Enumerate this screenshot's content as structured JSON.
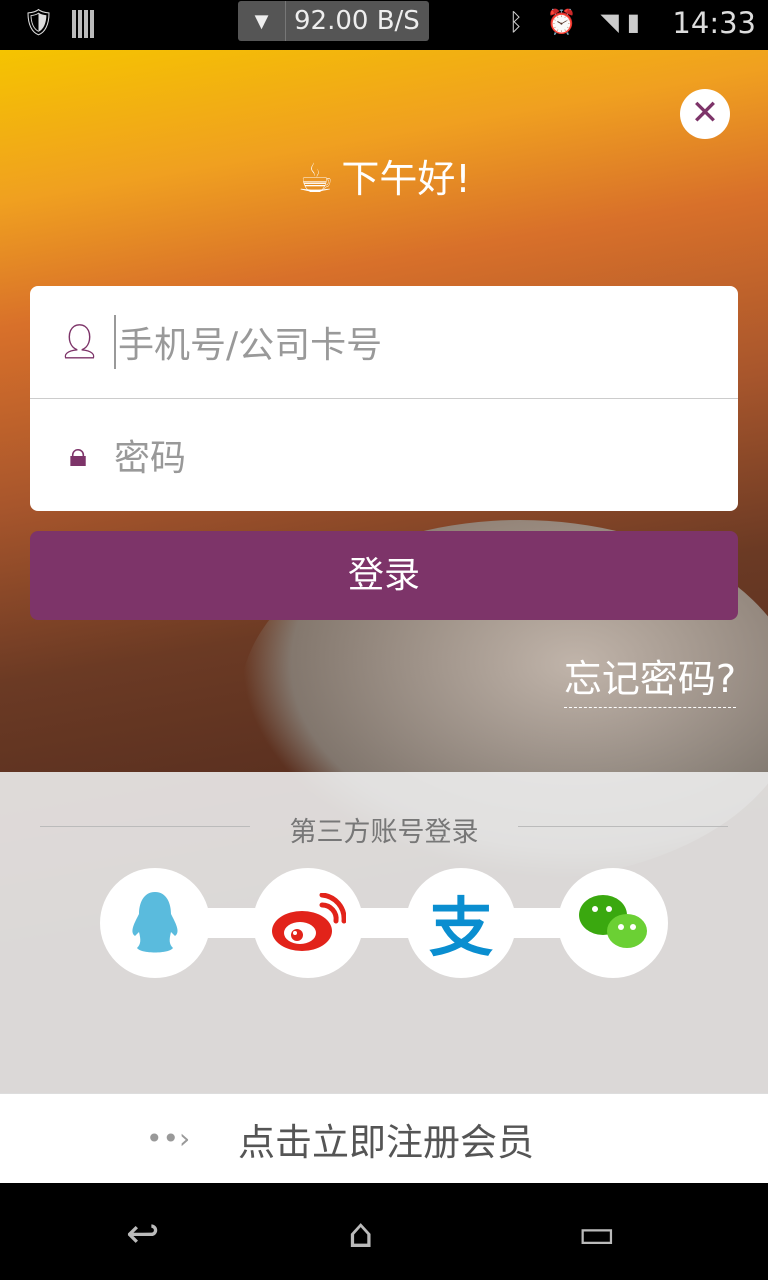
{
  "status_bar": {
    "net_speed": "92.00 B/S",
    "time": "14:33",
    "icons": [
      "shield-icon",
      "barcode-icon",
      "bluetooth-icon",
      "alarm-icon",
      "wifi-icon",
      "signal-icon",
      "battery-charging-icon"
    ]
  },
  "greeting": "下午好!",
  "form": {
    "username_placeholder": "手机号/公司卡号",
    "password_placeholder": "密码",
    "login_label": "登录",
    "forgot_label": "忘记密码?"
  },
  "third_party": {
    "title": "第三方账号登录",
    "providers": [
      "QQ",
      "Weibo",
      "Alipay",
      "WeChat"
    ]
  },
  "register_label": "点击立即注册会员",
  "colors": {
    "accent": "#7d3469",
    "qq": "#5abbdd",
    "weibo": "#e2231a",
    "alipay": "#0a8ed0",
    "wechat": "#3aa80f"
  }
}
